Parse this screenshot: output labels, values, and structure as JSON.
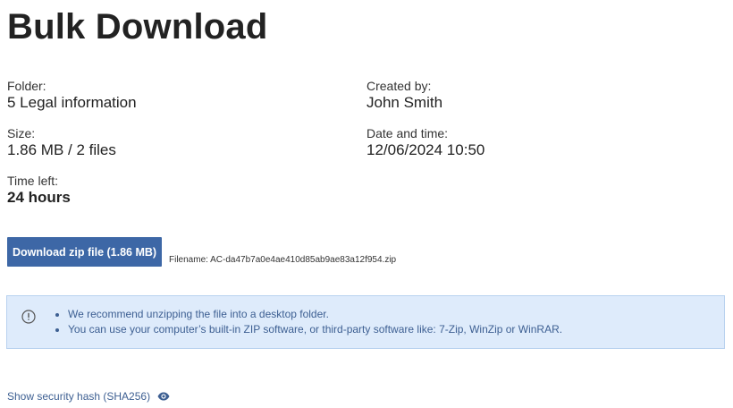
{
  "page": {
    "title": "Bulk Download"
  },
  "details": {
    "folder_label": "Folder:",
    "folder_value": "5 Legal information",
    "created_by_label": "Created by:",
    "created_by_value": "John Smith",
    "size_label": "Size:",
    "size_value": "1.86 MB / 2 files",
    "date_label": "Date and time:",
    "date_value": "12/06/2024 10:50",
    "time_left_label": "Time left:",
    "time_left_value": "24 hours"
  },
  "download": {
    "button_label": "Download zip file (1.86 MB)",
    "filename": "Filename: AC-da47b7a0e4ae410d85ab9ae83a12f954.zip"
  },
  "info": {
    "icon": "info-circle-icon",
    "items": [
      "We recommend unzipping the file into a desktop folder.",
      "You can use your computer’s built-in ZIP software, or third-party software like: 7-Zip, WinZip or WinRAR."
    ]
  },
  "hash": {
    "link_label": "Show security hash (SHA256)",
    "icon": "eye-icon"
  },
  "colors": {
    "primary_button": "#3d67a6",
    "info_background": "#deebfb",
    "info_border": "#b9d2ef",
    "link_text": "#3d5f92"
  }
}
